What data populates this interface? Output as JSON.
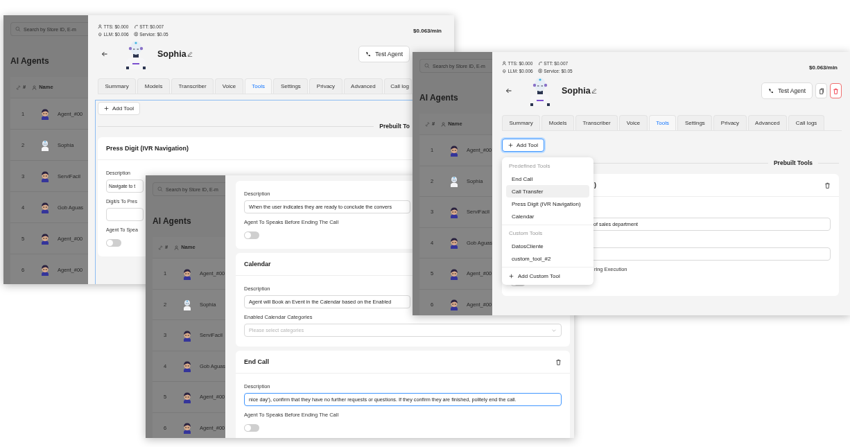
{
  "windows": [
    {
      "sidebar": {
        "search": {
          "placeholder": "Search by Store ID, E-m"
        },
        "title": "AI Agents",
        "columns": [
          "#",
          "Name"
        ],
        "rows": [
          {
            "number": "1",
            "name": "Agent_#00",
            "kind": "person"
          },
          {
            "number": "2",
            "name": "Sophia",
            "kind": "robot"
          },
          {
            "number": "3",
            "name": "ServiFacil",
            "kind": "person"
          },
          {
            "number": "4",
            "name": "Gob Aguas",
            "kind": "person"
          },
          {
            "number": "5",
            "name": "Agent_#00",
            "kind": "person"
          },
          {
            "number": "6",
            "name": "Agent_#00",
            "kind": "person"
          }
        ]
      },
      "panel": {
        "costs": [
          "TTS: $0.000",
          "STT: $0.007",
          "LLM: $0.006",
          "Service: $0.05"
        ],
        "rate": "$0.063/min",
        "agent": {
          "name": "Sophia",
          "test_button": "Test Agent"
        },
        "tabs": [
          {
            "label": "Summary",
            "selected": false
          },
          {
            "label": "Models",
            "selected": false
          },
          {
            "label": "Transcriber",
            "selected": false
          },
          {
            "label": "Voice",
            "selected": false
          },
          {
            "label": "Tools",
            "selected": true
          },
          {
            "label": "Settings",
            "selected": false
          },
          {
            "label": "Privacy",
            "selected": false
          },
          {
            "label": "Advanced",
            "selected": false
          },
          {
            "label": "Call log",
            "selected": false
          }
        ],
        "tools_focused": true,
        "add_tool": {
          "label": "Add Tool",
          "focused": false
        },
        "prebuilt_label": "Prebuilt To",
        "cards": [
          {
            "title": "Press Digit (IVR Navigation)",
            "fields": [
              {
                "kind": "label",
                "text": "Description"
              },
              {
                "kind": "input",
                "value": "Navigate to t",
                "focused": false
              },
              {
                "kind": "label",
                "text": "Digit/s To Pres"
              },
              {
                "kind": "input",
                "focused": false
              },
              {
                "kind": "label",
                "text": "Agent To Spea"
              },
              {
                "kind": "toggle",
                "on": false
              }
            ]
          }
        ]
      }
    },
    {
      "sidebar": {
        "search": {
          "placeholder": "Search by Store ID, E-m"
        },
        "title": "AI Agents",
        "columns": [
          "#",
          "Name"
        ],
        "rows": [
          {
            "number": "1",
            "name": "Agent_#00",
            "kind": "person"
          },
          {
            "number": "2",
            "name": "Sophia",
            "kind": "robot"
          },
          {
            "number": "3",
            "name": "ServiFacil",
            "kind": "person"
          },
          {
            "number": "4",
            "name": "Gob Aguas",
            "kind": "person"
          },
          {
            "number": "5",
            "name": "Agent_#00",
            "kind": "person"
          },
          {
            "number": "6",
            "name": "Agent_#00",
            "kind": "person"
          }
        ]
      },
      "panel": {
        "cards": [
          {
            "fields": [
              {
                "kind": "label",
                "text": "Description"
              },
              {
                "kind": "input",
                "value": "When the user indicates they are ready to conclude the convers",
                "focused": false
              },
              {
                "kind": "label",
                "text": "Agent To Speaks Before Ending The Call"
              },
              {
                "kind": "toggle",
                "on": false
              }
            ]
          },
          {
            "title": "Calendar",
            "fields": [
              {
                "kind": "label",
                "text": "Description"
              },
              {
                "kind": "input",
                "value": "Agent will Book an Event in the Calendar based on the Enabled",
                "focused": false
              },
              {
                "kind": "label",
                "text": "Enabled Calendar Categories"
              },
              {
                "kind": "select",
                "placeholder": "Please select categories"
              }
            ]
          },
          {
            "title": "End Call",
            "deletable": true,
            "fields": [
              {
                "kind": "label",
                "text": "Description"
              },
              {
                "kind": "input",
                "value": "nice day'), confirm that they have no further requests or questions. If they confirm they are finished, politely end the call.",
                "focused": true
              },
              {
                "kind": "label",
                "text": "Agent To Speaks Before Ending The Call"
              },
              {
                "kind": "toggle",
                "on": false
              }
            ]
          }
        ]
      }
    },
    {
      "sidebar": {
        "search": {
          "placeholder": "Search by Store ID, E-m"
        },
        "title": "AI Agents",
        "columns": [
          "#",
          "Name"
        ],
        "rows": [
          {
            "number": "1",
            "name": "Agent_#00",
            "kind": "person"
          },
          {
            "number": "2",
            "name": "Sophia",
            "kind": "robot"
          },
          {
            "number": "3",
            "name": "ServiFacil",
            "kind": "person"
          },
          {
            "number": "4",
            "name": "Gob Aguas",
            "kind": "person"
          },
          {
            "number": "5",
            "name": "Agent_#00",
            "kind": "person"
          },
          {
            "number": "6",
            "name": "Agent_#00",
            "kind": "person"
          }
        ]
      },
      "panel": {
        "costs": [
          "TTS: $0.000",
          "STT: $0.007",
          "LLM: $0.006",
          "Service: $0.05"
        ],
        "rate": "$0.063/min",
        "agent": {
          "name": "Sophia",
          "test_button": "Test Agent",
          "icon_buttons": [
            {
              "kind": "copy"
            },
            {
              "kind": "delete"
            }
          ]
        },
        "tabs": [
          {
            "label": "Summary",
            "selected": false
          },
          {
            "label": "Models",
            "selected": false
          },
          {
            "label": "Transcriber",
            "selected": false
          },
          {
            "label": "Voice",
            "selected": false
          },
          {
            "label": "Tools",
            "selected": true
          },
          {
            "label": "Settings",
            "selected": false
          },
          {
            "label": "Privacy",
            "selected": false
          },
          {
            "label": "Advanced",
            "selected": false
          },
          {
            "label": "Call logs",
            "selected": false
          }
        ],
        "tools_focused": false,
        "add_tool": {
          "label": "Add Tool",
          "focused": true
        },
        "prebuilt_label": "Prebuilt Tools",
        "cards": [
          {
            "title": ")",
            "deletable": true,
            "fields": [
              {
                "kind": "input",
                "value": "of sales department",
                "focused": false
              },
              {
                "kind": "input",
                "focused": false
              },
              {
                "kind": "label",
                "text": "ring Execution"
              },
              {
                "kind": "toggle",
                "on": false
              }
            ]
          }
        ],
        "menu": {
          "groups": [
            {
              "heading": "Predefined Tools",
              "items": [
                {
                  "label": "End Call",
                  "selected": false
                },
                {
                  "label": "Call Transfer",
                  "selected": true
                },
                {
                  "label": "Press Digit (IVR Navigation)",
                  "selected": false
                },
                {
                  "label": "Calendar",
                  "selected": false
                }
              ]
            },
            {
              "heading": "Custom Tools",
              "items": [
                {
                  "label": "DatosCliente",
                  "selected": false
                },
                {
                  "label": "custom_tool_#2",
                  "selected": false
                }
              ]
            }
          ],
          "add_custom": "Add Custom Tool"
        }
      }
    }
  ]
}
